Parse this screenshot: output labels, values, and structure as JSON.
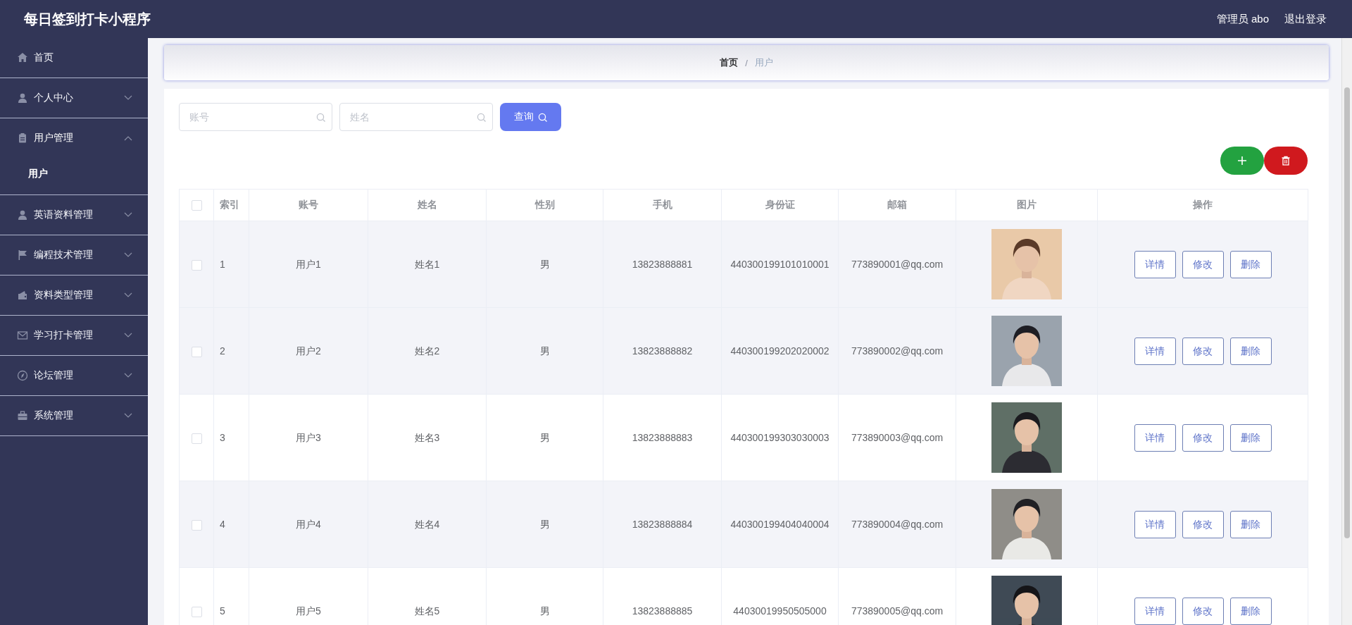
{
  "header": {
    "title": "每日签到打卡小程序",
    "user": "管理员 abo",
    "logout": "退出登录"
  },
  "sidebar": {
    "items": [
      {
        "label": "首页"
      },
      {
        "label": "个人中心",
        "expanded": false
      },
      {
        "label": "用户管理",
        "expanded": true,
        "children": [
          {
            "label": "用户",
            "selected": true
          }
        ]
      },
      {
        "label": "英语资料管理",
        "expanded": false
      },
      {
        "label": "编程技术管理",
        "expanded": false
      },
      {
        "label": "资料类型管理",
        "expanded": false
      },
      {
        "label": "学习打卡管理",
        "expanded": false
      },
      {
        "label": "论坛管理",
        "expanded": false
      },
      {
        "label": "系统管理",
        "expanded": false
      }
    ]
  },
  "breadcrumb": {
    "separator": "/",
    "items": [
      {
        "label": "首页",
        "current": false
      },
      {
        "label": "用户",
        "current": true
      }
    ]
  },
  "search": {
    "fields": [
      {
        "placeholder": "账号"
      },
      {
        "placeholder": "姓名"
      }
    ],
    "button": "查询"
  },
  "toolbar": [
    {
      "kind": "add"
    },
    {
      "kind": "delete"
    }
  ],
  "table": {
    "all_checked": false,
    "columns": [
      "索引",
      "账号",
      "姓名",
      "性别",
      "手机",
      "身份证",
      "邮箱",
      "图片",
      "操作"
    ],
    "rows": [
      {
        "checked": false,
        "highlighted": true,
        "cells": [
          "1",
          "用户1",
          "姓名1",
          "男",
          "13823888881",
          "440300199101010001",
          "773890001@qq.com"
        ],
        "actions": [
          "详情",
          "修改",
          "删除"
        ]
      },
      {
        "checked": false,
        "highlighted": true,
        "cells": [
          "2",
          "用户2",
          "姓名2",
          "男",
          "13823888882",
          "440300199202020002",
          "773890002@qq.com"
        ],
        "actions": [
          "详情",
          "修改",
          "删除"
        ]
      },
      {
        "checked": false,
        "highlighted": false,
        "cells": [
          "3",
          "用户3",
          "姓名3",
          "男",
          "13823888883",
          "440300199303030003",
          "773890003@qq.com"
        ],
        "actions": [
          "详情",
          "修改",
          "删除"
        ]
      },
      {
        "checked": false,
        "highlighted": true,
        "cells": [
          "4",
          "用户4",
          "姓名4",
          "男",
          "13823888884",
          "440300199404040004",
          "773890004@qq.com"
        ],
        "actions": [
          "详情",
          "修改",
          "删除"
        ]
      },
      {
        "checked": false,
        "highlighted": false,
        "cells": [
          "5",
          "用户5",
          "姓名5",
          "男",
          "13823888885",
          "44030019950505000",
          "773890005@qq.com"
        ],
        "actions": [
          "详情",
          "修改",
          "删除"
        ]
      }
    ]
  }
}
